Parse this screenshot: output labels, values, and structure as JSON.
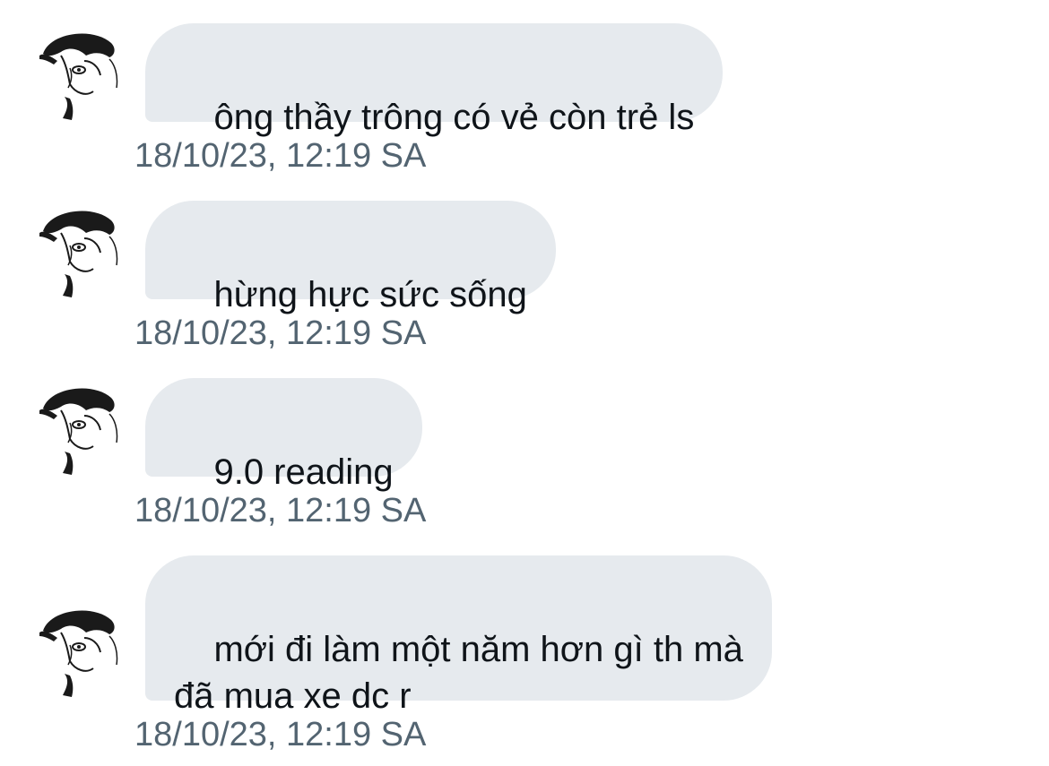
{
  "conversation": {
    "messages": [
      {
        "text": "ông thầy trông có vẻ còn trẻ ls",
        "timestamp": "18/10/23, 12:19 SA"
      },
      {
        "text": "hừng hực sức sống",
        "timestamp": "18/10/23, 12:19 SA"
      },
      {
        "text": "9.0 reading",
        "timestamp": "18/10/23, 12:19 SA"
      },
      {
        "text": "mới đi làm một năm hơn gì th mà\nđã mua xe dc r",
        "timestamp": "18/10/23, 12:19 SA"
      }
    ]
  },
  "colors": {
    "bubble_background": "#e6eaee",
    "message_text": "#0f1419",
    "timestamp_text": "#536471"
  },
  "icons": {
    "avatar": "manga-character-avatar-icon"
  }
}
